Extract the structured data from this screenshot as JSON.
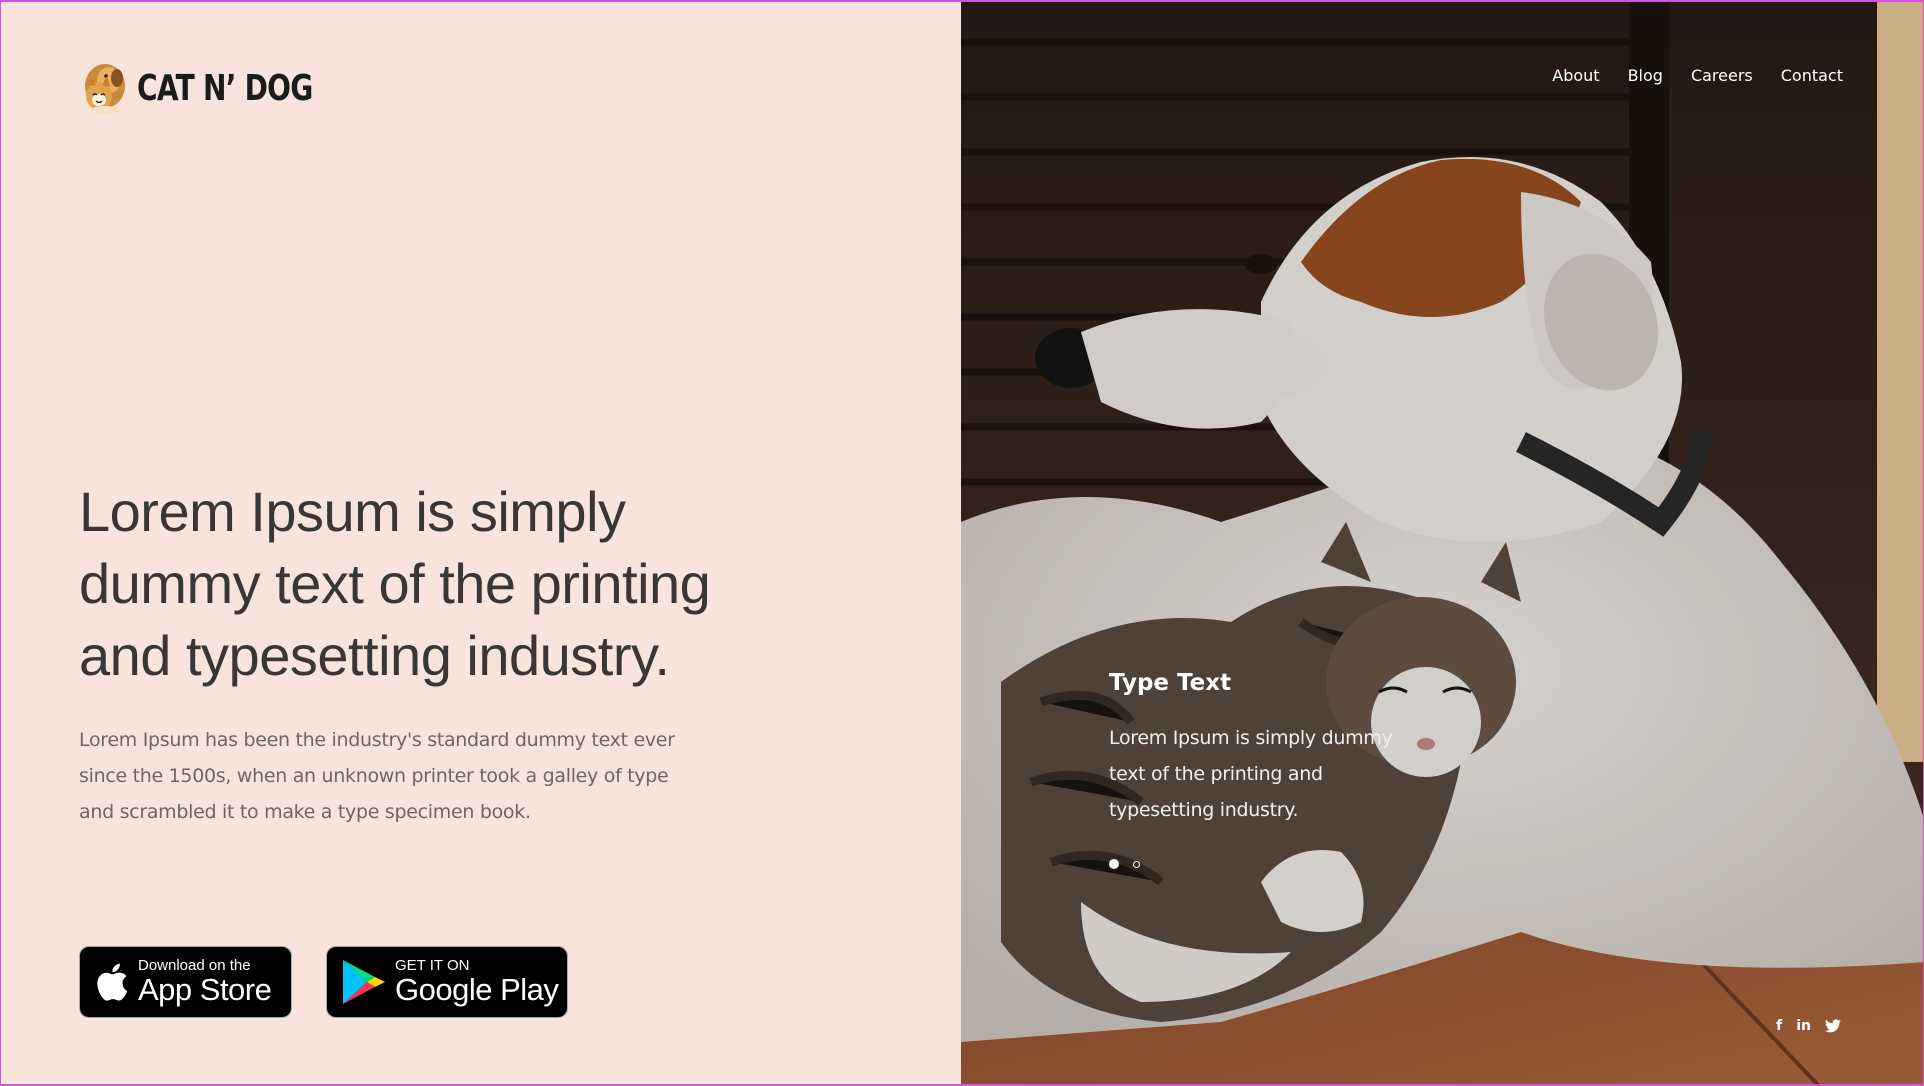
{
  "brand": {
    "name": "CAT N’ DOG",
    "logo_icon": "cat-dog-logo-icon"
  },
  "nav": {
    "items": [
      {
        "label": "About"
      },
      {
        "label": "Blog"
      },
      {
        "label": "Careers"
      },
      {
        "label": "Contact"
      }
    ]
  },
  "hero": {
    "title": "Lorem Ipsum is simply dummy text of the printing and typesetting industry.",
    "description": "Lorem Ipsum has been the industry's standard dummy text ever since the 1500s, when an unknown printer took a galley of type and scrambled it to make a type specimen book."
  },
  "stores": {
    "appstore": {
      "small": "Download on the",
      "big": "App Store"
    },
    "googleplay": {
      "small": "GET IT ON",
      "big": "Google Play"
    }
  },
  "slide": {
    "title": "Type Text",
    "text": "Lorem Ipsum is simply dummy text of the printing and typesetting industry.",
    "count": 2,
    "active_index": 0
  },
  "social": {
    "facebook": "f",
    "linkedin": "in"
  },
  "colors": {
    "left_bg": "#f9e4dc",
    "heading": "#3a3636",
    "body_text": "#6e6563",
    "button_bg": "#000000",
    "frame": "#d452e0"
  }
}
